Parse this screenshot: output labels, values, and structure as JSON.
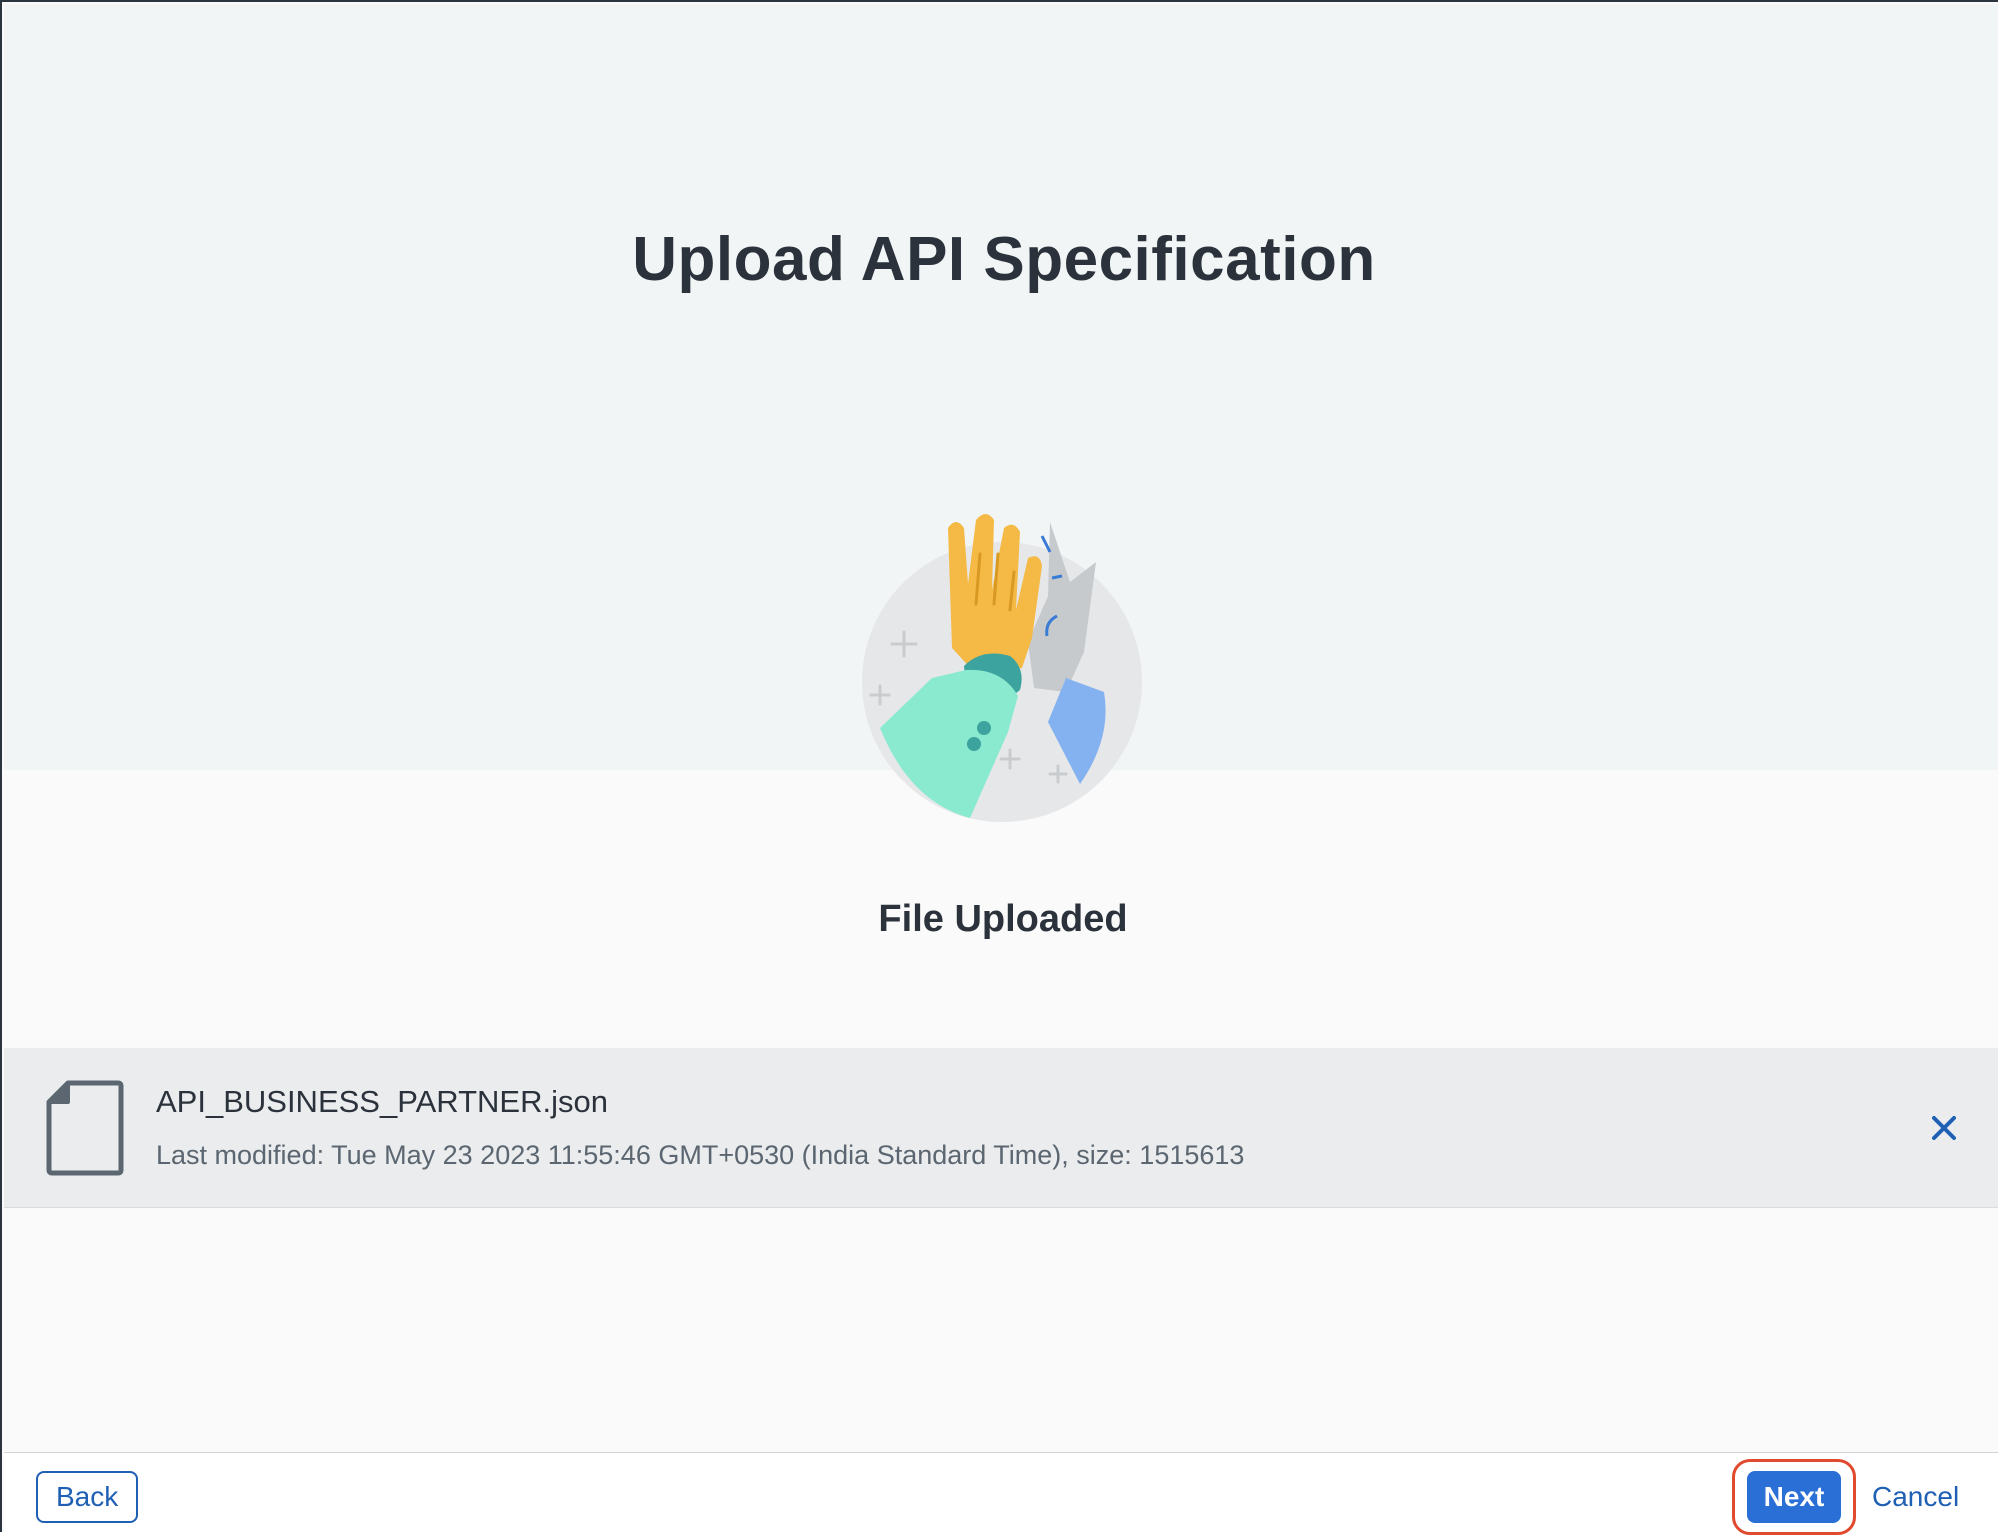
{
  "dialog": {
    "title": "Upload API Specification"
  },
  "illustration": {
    "icon": "high-five-illustration"
  },
  "status": {
    "text": "File Uploaded"
  },
  "file": {
    "name": "API_BUSINESS_PARTNER.json",
    "meta": "Last modified: Tue May 23 2023 11:55:46 GMT+0530 (India Standard Time), size: 1515613",
    "icon": "document-icon",
    "remove_icon": "close-icon"
  },
  "footer": {
    "back_label": "Back",
    "next_label": "Next",
    "cancel_label": "Cancel"
  },
  "colors": {
    "accent": "#2a6fd6",
    "link": "#1f5fb4",
    "highlight_outline": "#e04a2f",
    "header_band": "#f1f5f6",
    "file_row": "#eaecee"
  }
}
